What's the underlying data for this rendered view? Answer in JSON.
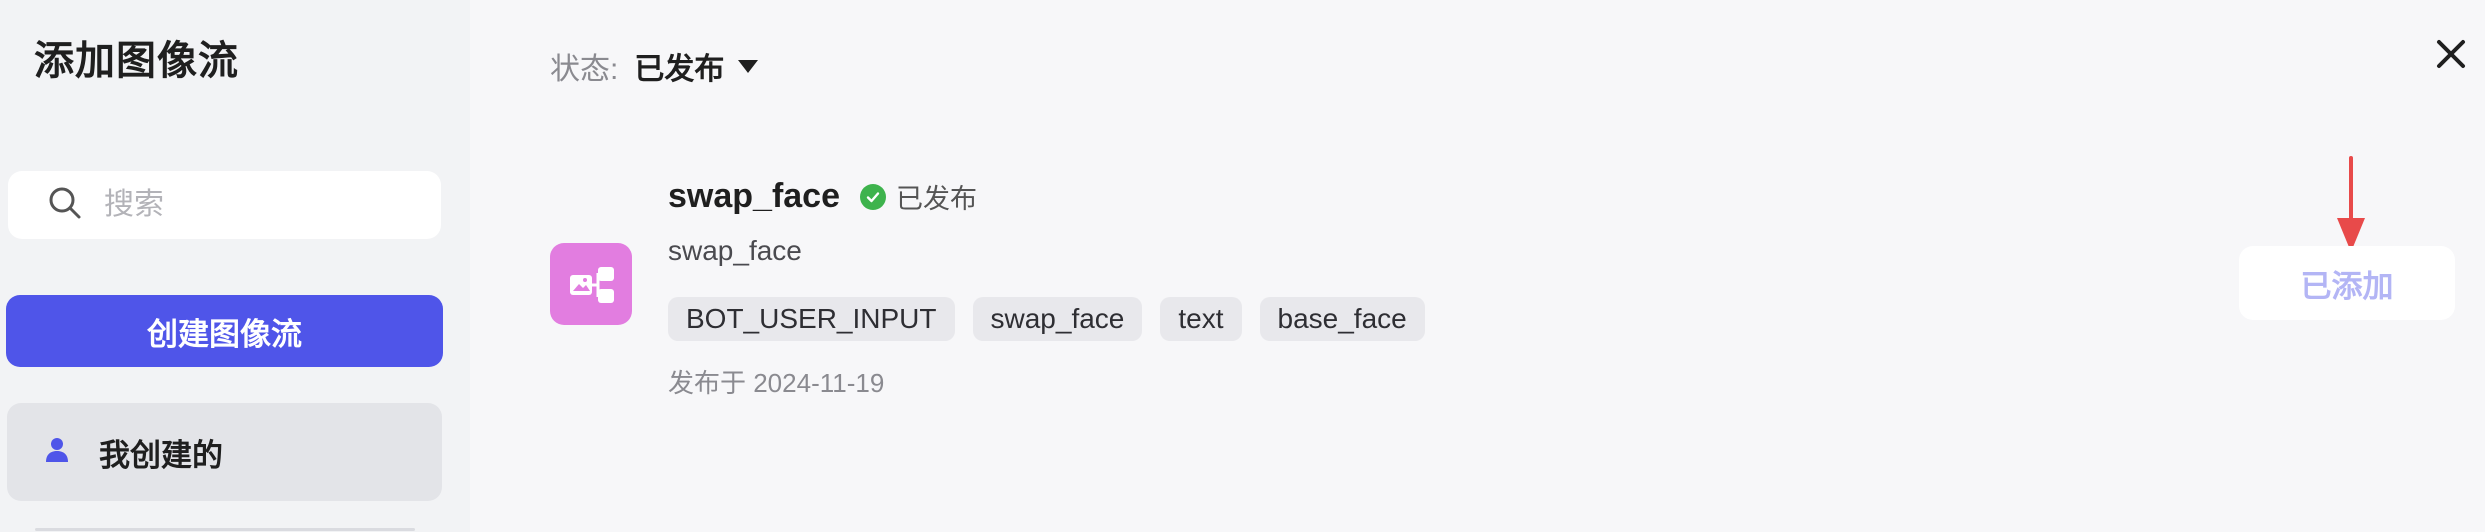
{
  "sidebar": {
    "title": "添加图像流",
    "search": {
      "placeholder": "搜索",
      "value": ""
    },
    "create_button": "创建图像流",
    "nav_items": [
      {
        "label": "我创建的",
        "icon": "user-icon",
        "selected": true
      }
    ]
  },
  "main": {
    "status_filter": {
      "label": "状态:",
      "value": "已发布"
    },
    "close_icon": "close-icon",
    "workflow": {
      "icon": "workflow-icon",
      "name": "swap_face",
      "status": "已发布",
      "description": "swap_face",
      "tags": [
        "BOT_USER_INPUT",
        "swap_face",
        "text",
        "base_face"
      ],
      "published_date": "发布于 2024-11-19",
      "action_label": "已添加"
    }
  },
  "colors": {
    "accent": "#4f55e9",
    "published_green": "#3eb34d",
    "workflow_icon_bg": "#e27de0",
    "annotation_red": "#e84a4a"
  }
}
